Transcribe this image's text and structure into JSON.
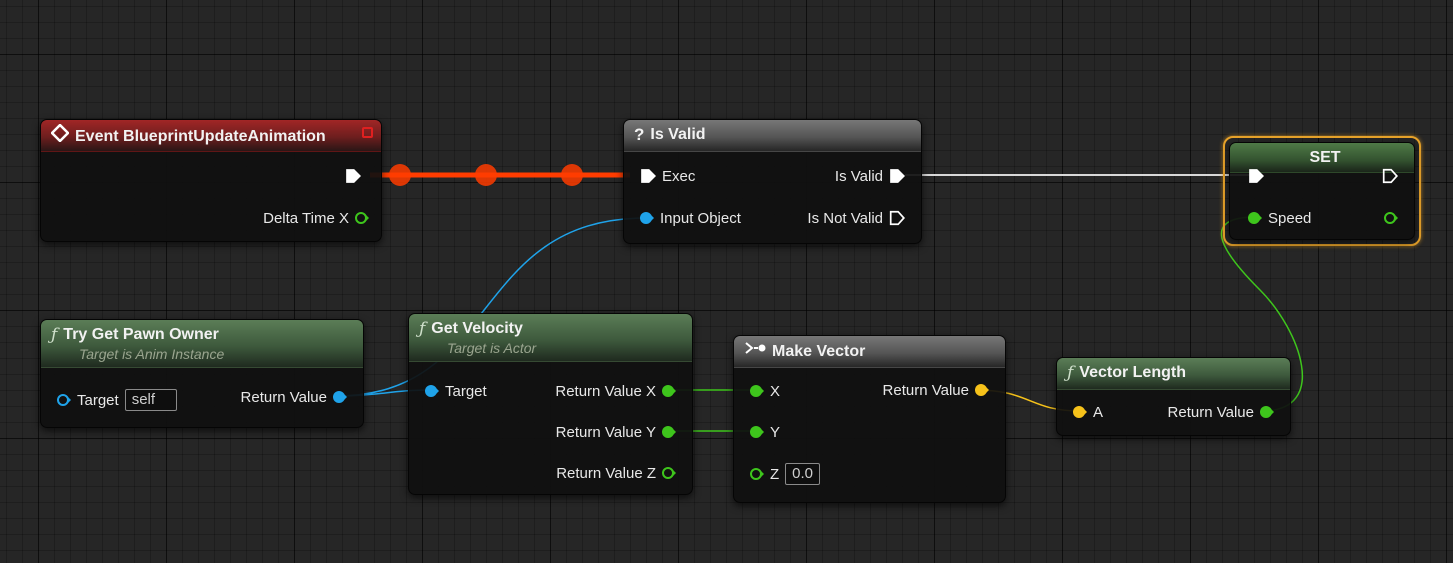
{
  "nodes": {
    "event": {
      "title": "Event BlueprintUpdateAnimation",
      "pin_delta": "Delta Time X"
    },
    "is_valid": {
      "title": "Is Valid",
      "pin_exec": "Exec",
      "pin_input": "Input Object",
      "pin_valid": "Is Valid",
      "pin_not_valid": "Is Not Valid"
    },
    "set": {
      "title": "SET",
      "pin_speed": "Speed"
    },
    "try_get_pawn": {
      "title": "Try Get Pawn Owner",
      "subtitle": "Target is Anim Instance",
      "pin_target": "Target",
      "target_value": "self",
      "pin_return": "Return Value"
    },
    "get_velocity": {
      "title": "Get Velocity",
      "subtitle": "Target is Actor",
      "pin_target": "Target",
      "pin_rx": "Return Value X",
      "pin_ry": "Return Value Y",
      "pin_rz": "Return Value Z"
    },
    "make_vector": {
      "title": "Make Vector",
      "pin_x": "X",
      "pin_y": "Y",
      "pin_z": "Z",
      "z_value": "0.0",
      "pin_return": "Return Value"
    },
    "vector_length": {
      "title": "Vector Length",
      "pin_a": "A",
      "pin_return": "Return Value"
    }
  },
  "colors": {
    "exec_wire": "#ff3c00",
    "exec_wire_plain": "#d8d8d8",
    "object_pin": "#1fa3ea",
    "float_pin": "#3ec51c",
    "vector_pin": "#f6c21a"
  },
  "icons": {
    "event": "event-diamond-icon",
    "is_valid": "question-mark-icon",
    "function": "function-f-icon",
    "make_vector": "make-struct-icon"
  }
}
